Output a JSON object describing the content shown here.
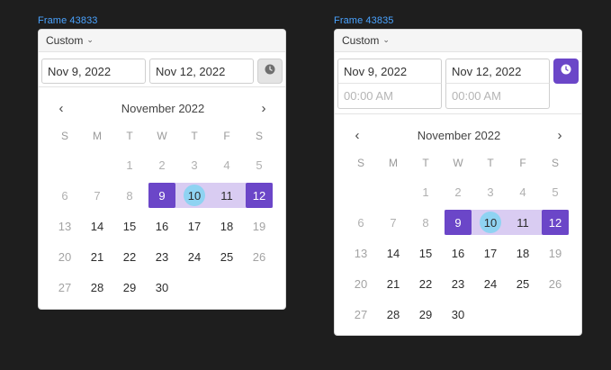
{
  "frames": [
    {
      "label": "Frame 43833",
      "range_type": "Custom",
      "start_date": "Nov 9, 2022",
      "end_date": "Nov 12, 2022",
      "time_enabled": false,
      "month": "November 2022"
    },
    {
      "label": "Frame 43835",
      "range_type": "Custom",
      "start_date": "Nov 9, 2022",
      "end_date": "Nov 12, 2022",
      "start_time_placeholder": "00:00 AM",
      "end_time_placeholder": "00:00 AM",
      "time_enabled": true,
      "month": "November 2022"
    }
  ],
  "weekdays": [
    "S",
    "M",
    "T",
    "W",
    "T",
    "F",
    "S"
  ],
  "nav": {
    "prev": "‹",
    "next": "›"
  },
  "dropdown_caret": "⌄",
  "calendar": {
    "first_weekday_index": 2,
    "days_in_month": 30,
    "range_start": 9,
    "range_end": 12,
    "today": 10
  },
  "colors": {
    "accent": "#6b46c8",
    "range": "#d9ccf2",
    "today": "#8fd3f2",
    "frame_label": "#4aa3ff"
  },
  "icons": {
    "clock": "clock-icon",
    "caret": "chevron-down-icon",
    "prev": "chevron-left-icon",
    "next": "chevron-right-icon"
  }
}
